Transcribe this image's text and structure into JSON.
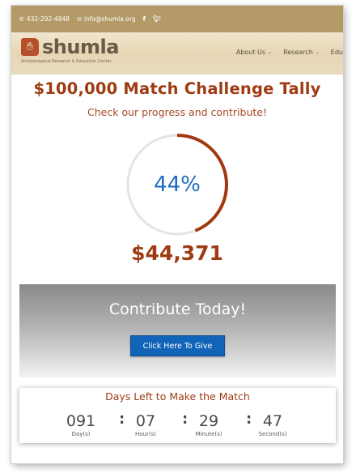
{
  "topbar": {
    "phone": "432-292-4848",
    "email": "info@shumla.org",
    "social": [
      "facebook-icon",
      "twitter-icon"
    ]
  },
  "logo": {
    "name": "shumla",
    "tagline": "Archaeological Research & Education Center"
  },
  "nav": {
    "items": [
      {
        "label": "About Us"
      },
      {
        "label": "Research"
      },
      {
        "label": "Edu"
      }
    ]
  },
  "main": {
    "title": "$100,000 Match Challenge Tally",
    "subtitle": "Check our progress and contribute!",
    "progress_percent": 44,
    "progress_label": "44%",
    "amount": "$44,371"
  },
  "contribute": {
    "title": "Contribute Today!",
    "button_label": "Click Here To Give"
  },
  "countdown": {
    "title": "Days Left to Make the Match",
    "units": [
      {
        "value": "091",
        "label": "Day(s)"
      },
      {
        "value": "07",
        "label": "Hour(s)"
      },
      {
        "value": "29",
        "label": "Minute(s)"
      },
      {
        "value": "47",
        "label": "Second(s)"
      }
    ],
    "separator": ":"
  },
  "colors": {
    "accent": "#9e3b13",
    "button": "#1164b7",
    "topbar": "#b39a66"
  }
}
